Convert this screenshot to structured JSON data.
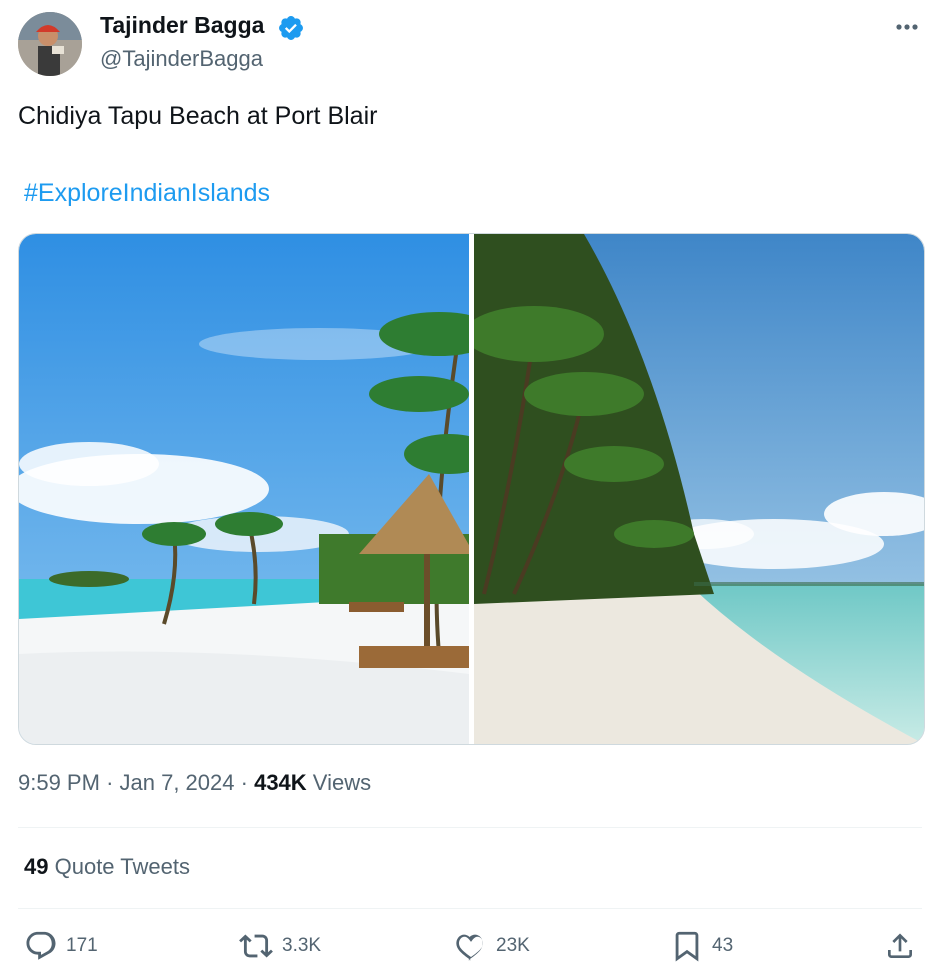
{
  "author": {
    "name": "Tajinder Bagga",
    "handle": "@TajinderBagga"
  },
  "tweet": {
    "text": "Chidiya Tapu Beach at Port Blair",
    "hashtag": "#ExploreIndianIslands"
  },
  "media": {
    "photos": [
      "beach-photo-palms-huts",
      "beach-photo-palm-shore"
    ]
  },
  "meta": {
    "time": "9:59 PM",
    "date": "Jan 7, 2024",
    "separator": "·",
    "views_count": "434K",
    "views_label": "Views"
  },
  "quotes": {
    "count": "49",
    "label": "Quote Tweets"
  },
  "actions": {
    "reply_count": "171",
    "retweet_count": "3.3K",
    "like_count": "23K",
    "bookmark_count": "43"
  },
  "icons": [
    "verified-badge-icon",
    "more-options-icon",
    "reply-icon",
    "retweet-icon",
    "like-icon",
    "bookmark-icon",
    "share-icon"
  ],
  "colors": {
    "link": "#1d9bf0",
    "secondary_text": "#536471",
    "primary_text": "#0f1419"
  }
}
